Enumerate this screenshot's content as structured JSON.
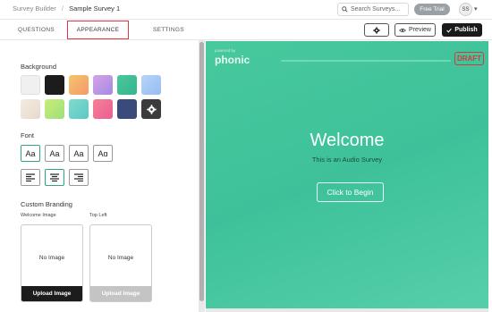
{
  "header": {
    "breadcrumb_root": "Survey Builder",
    "breadcrumb_separator": "/",
    "breadcrumb_current": "Sample Survey 1",
    "search_placeholder": "Search Surveys...",
    "trial_label": "Free Trial",
    "avatar_initials": "SS"
  },
  "tabs": [
    {
      "label": "QUESTIONS"
    },
    {
      "label": "APPEARANCE",
      "active": true
    },
    {
      "label": "SETTINGS"
    }
  ],
  "toolbar": {
    "preview_label": "Preview",
    "publish_label": "Publish"
  },
  "panel": {
    "background_label": "Background",
    "font_label": "Font",
    "branding_label": "Custom Branding",
    "welcome_image_label": "Welcome Image",
    "top_left_label": "Top Left",
    "no_image_text": "No Image",
    "upload_label": "Upload Image"
  },
  "background_swatches": [
    "#f0f0f0",
    "#1c1c1c",
    "#f4b36a",
    "#c79be0",
    "#3fbf95",
    "#a9c8f5",
    "#eee3d6",
    "#b5e47a",
    "#6ad3c9",
    "#ef6f95",
    "#3a4a7a"
  ],
  "font_options": [
    "Aa",
    "Aa",
    "Aa",
    "Aɑ"
  ],
  "preview": {
    "powered_by": "powered by",
    "logo": "phonic",
    "draft_label": "DRAFT",
    "title": "Welcome",
    "subtitle": "This is an Audio Survey",
    "begin_label": "Click to Begin"
  },
  "colors": {
    "accent_green": "#2da87a",
    "preview_bg": "#48c89d",
    "highlight_red": "#e0383e"
  }
}
